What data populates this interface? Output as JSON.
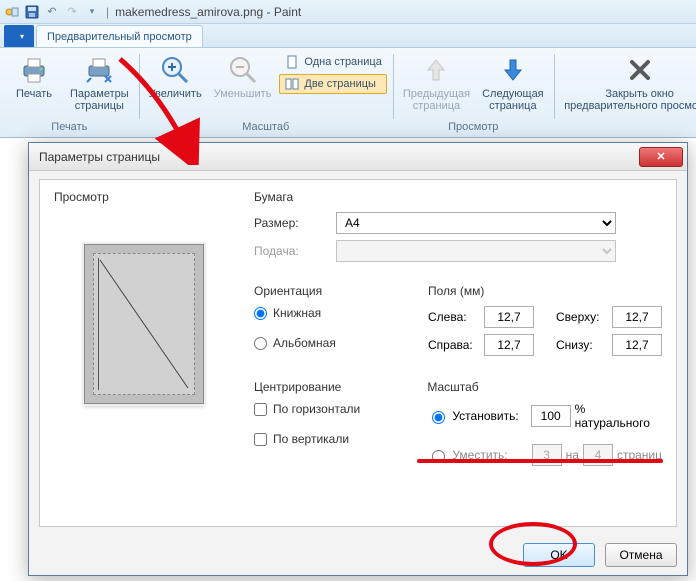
{
  "app": {
    "filename": "makemedress_amirova.png",
    "appname": "Paint",
    "title_sep": "|"
  },
  "tabs": {
    "file": "",
    "preview": "Предварительный просмотр"
  },
  "ribbon": {
    "groups": {
      "print": {
        "label": "Печать",
        "print": "Печать",
        "page_setup": "Параметры\nстраницы"
      },
      "zoom": {
        "label": "Масштаб",
        "zoom_in": "Увеличить",
        "zoom_out": "Уменьшить",
        "one_page": "Одна страница",
        "two_pages": "Две страницы"
      },
      "view": {
        "label": "Просмотр",
        "prev": "Предыдущая\nстраница",
        "next": "Следующая\nстраница"
      },
      "close": {
        "label": "",
        "close": "Закрыть окно\nпредварительного просмотра"
      }
    }
  },
  "dialog": {
    "title": "Параметры страницы",
    "preview_label": "Просмотр",
    "paper": {
      "label": "Бумага",
      "size_label": "Размер:",
      "size_value": "A4",
      "source_label": "Подача:",
      "source_value": ""
    },
    "orientation": {
      "label": "Ориентация",
      "portrait": "Книжная",
      "landscape": "Альбомная"
    },
    "margins": {
      "label": "Поля (мм)",
      "left_label": "Слева:",
      "left": "12,7",
      "top_label": "Сверху:",
      "top": "12,7",
      "right_label": "Справа:",
      "right": "12,7",
      "bottom_label": "Снизу:",
      "bottom": "12,7"
    },
    "centering": {
      "label": "Центрирование",
      "horiz": "По горизонтали",
      "vert": "По вертикали"
    },
    "scaling": {
      "label": "Масштаб",
      "adjust": "Установить:",
      "adjust_value": "100",
      "adjust_suffix": "% натурального",
      "fit": "Уместить:",
      "fit_w": "3",
      "fit_sep": "на",
      "fit_h": "4",
      "fit_suffix": "страниц"
    },
    "ok": "OK",
    "cancel": "Отмена"
  }
}
